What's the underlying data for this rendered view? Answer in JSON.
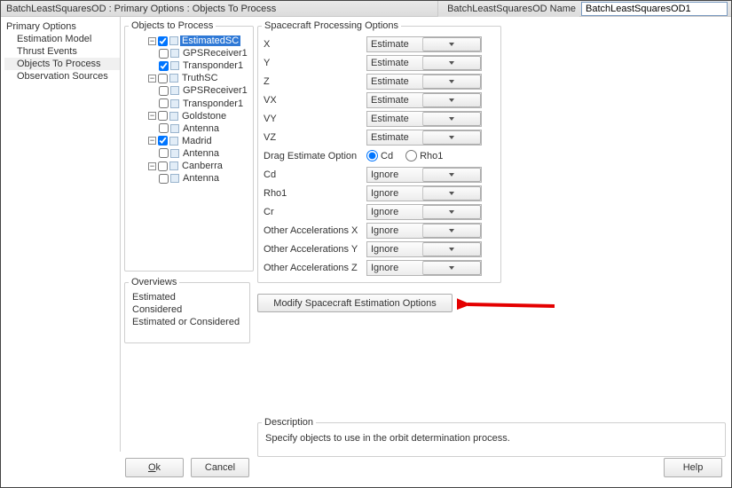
{
  "header": {
    "breadcrumb": "BatchLeastSquaresOD : Primary Options : Objects To Process",
    "name_label": "BatchLeastSquaresOD Name",
    "name_value": "BatchLeastSquaresOD1"
  },
  "nav": {
    "root": "Primary Options",
    "items": [
      {
        "label": "Estimation Model",
        "selected": false
      },
      {
        "label": "Thrust Events",
        "selected": false
      },
      {
        "label": "Objects To Process",
        "selected": true
      },
      {
        "label": "Observation Sources",
        "selected": false
      }
    ]
  },
  "objects_panel": {
    "title": "Objects to Process",
    "tree": [
      {
        "label": "EstimatedSC",
        "checked": true,
        "expanded": true,
        "selected": true,
        "children": [
          {
            "label": "GPSReceiver1",
            "checked": false
          },
          {
            "label": "Transponder1",
            "checked": true
          }
        ]
      },
      {
        "label": "TruthSC",
        "checked": false,
        "expanded": true,
        "children": [
          {
            "label": "GPSReceiver1",
            "checked": false
          },
          {
            "label": "Transponder1",
            "checked": false
          }
        ]
      },
      {
        "label": "Goldstone",
        "checked": false,
        "expanded": true,
        "children": [
          {
            "label": "Antenna",
            "checked": false
          }
        ]
      },
      {
        "label": "Madrid",
        "checked": true,
        "expanded": true,
        "children": [
          {
            "label": "Antenna",
            "checked": false
          }
        ]
      },
      {
        "label": "Canberra",
        "checked": false,
        "expanded": true,
        "children": [
          {
            "label": "Antenna",
            "checked": false
          }
        ]
      }
    ]
  },
  "overviews_panel": {
    "title": "Overviews",
    "items": [
      "Estimated",
      "Considered",
      "Estimated or Considered"
    ]
  },
  "spo_panel": {
    "title": "Spacecraft Processing Options",
    "rows": [
      {
        "label": "X",
        "value": "Estimate"
      },
      {
        "label": "Y",
        "value": "Estimate"
      },
      {
        "label": "Z",
        "value": "Estimate"
      },
      {
        "label": "VX",
        "value": "Estimate"
      },
      {
        "label": "VY",
        "value": "Estimate"
      },
      {
        "label": "VZ",
        "value": "Estimate"
      }
    ],
    "drag_label": "Drag Estimate Option",
    "drag_opts": {
      "cd": "Cd",
      "rho1": "Rho1",
      "selected": "cd"
    },
    "rows2": [
      {
        "label": "Cd",
        "value": "Ignore"
      },
      {
        "label": "Rho1",
        "value": "Ignore"
      },
      {
        "label": "Cr",
        "value": "Ignore"
      },
      {
        "label": "Other Accelerations X",
        "value": "Ignore"
      },
      {
        "label": "Other Accelerations Y",
        "value": "Ignore"
      },
      {
        "label": "Other Accelerations Z",
        "value": "Ignore"
      }
    ],
    "modify_button": "Modify Spacecraft Estimation Options"
  },
  "description": {
    "title": "Description",
    "text": "Specify objects to use in the orbit determination process."
  },
  "footer": {
    "ok": "Ok",
    "cancel": "Cancel",
    "help": "Help"
  }
}
